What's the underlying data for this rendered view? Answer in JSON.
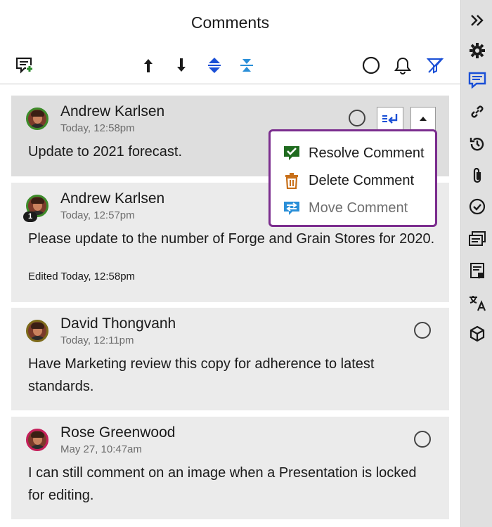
{
  "header": {
    "title": "Comments"
  },
  "toolbar": {
    "icons": [
      "add-comment-icon",
      "arrow-up-icon",
      "arrow-down-icon",
      "expand-all-icon",
      "collapse-all-icon",
      "resolve-circle-icon",
      "bell-icon",
      "filter-off-icon"
    ],
    "colors": {
      "green": "#2e8b2e",
      "blue": "#1a4fd6",
      "teal": "#2a8fd8"
    }
  },
  "comments": [
    {
      "author": "Andrew Karlsen",
      "time": "Today, 12:58pm",
      "body": "Update to 2021 forecast.",
      "selected": true
    },
    {
      "author": "Andrew Karlsen",
      "time": "Today, 12:57pm",
      "body": "Please update to the number of Forge and Grain Stores for 2020.",
      "edited": "Edited Today, 12:58pm",
      "badge": "1"
    },
    {
      "author": "David Thongvanh",
      "time": "Today, 12:11pm",
      "body": "Have Marketing review this copy for adherence to latest standards."
    },
    {
      "author": "Rose Greenwood",
      "time": "May 27, 10:47am",
      "body": "I can still comment on an image when a Presentation is locked for editing."
    }
  ],
  "menu": {
    "items": [
      {
        "label": "Resolve Comment",
        "icon": "resolve-check-icon",
        "color": "#1f6b1f"
      },
      {
        "label": "Delete Comment",
        "icon": "trash-icon",
        "color": "#c8701a"
      },
      {
        "label": "Move Comment",
        "icon": "move-arrows-icon",
        "color": "#2a8fd8",
        "disabled": true
      }
    ]
  },
  "rail": {
    "icons": [
      "collapse-panel-icon",
      "settings-gear-icon",
      "comments-icon",
      "link-icon",
      "history-icon",
      "attachment-icon",
      "tasks-check-icon",
      "copy-icon",
      "notes-icon",
      "translate-icon",
      "cube-icon"
    ],
    "active": "comments-icon",
    "active_color": "#1a4fd6"
  }
}
